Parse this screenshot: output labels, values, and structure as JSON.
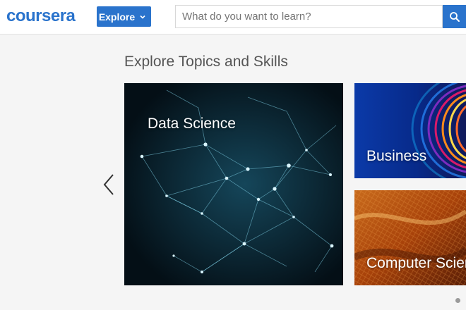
{
  "header": {
    "logo_text": "coursera",
    "explore_label": "Explore",
    "search_placeholder": "What do you want to learn?",
    "search_value": ""
  },
  "main": {
    "section_title": "Explore Topics and Skills",
    "cards": [
      {
        "label": "Data Science"
      },
      {
        "label": "Business"
      },
      {
        "label": "Computer Science"
      }
    ]
  },
  "icons": {
    "explore": "chevron-down-icon",
    "search": "search-icon",
    "carousel_prev": "chevron-left-icon",
    "pagination": "pagination-dot"
  },
  "colors": {
    "brand": "#2a73cc",
    "page_bg": "#f5f5f5",
    "heading": "#555555"
  }
}
